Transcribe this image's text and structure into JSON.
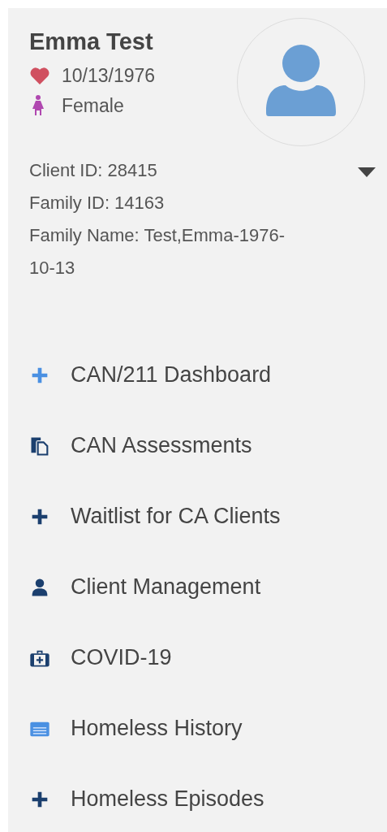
{
  "client": {
    "name": "Emma Test",
    "birth_date": "10/13/1976",
    "gender": "Female",
    "client_id": "Client ID: 28415",
    "family_id": "Family ID: 14163",
    "family_name": "Family Name: Test,Emma-1976-10-13"
  },
  "menu": [
    {
      "label": "CAN/211 Dashboard",
      "kind": "plus",
      "color": "#4a90e2"
    },
    {
      "label": "CAN Assessments",
      "kind": "copy",
      "color": "#1b3f6e"
    },
    {
      "label": "Waitlist for CA Clients",
      "kind": "plus",
      "color": "#1b3f6e"
    },
    {
      "label": "Client Management",
      "kind": "user",
      "color": "#1b3f6e"
    },
    {
      "label": "COVID-19",
      "kind": "medkit",
      "color": "#1b3f6e"
    },
    {
      "label": "Homeless History",
      "kind": "list",
      "color": "#4a90e2"
    },
    {
      "label": "Homeless Episodes",
      "kind": "plus",
      "color": "#1b3f6e"
    }
  ]
}
